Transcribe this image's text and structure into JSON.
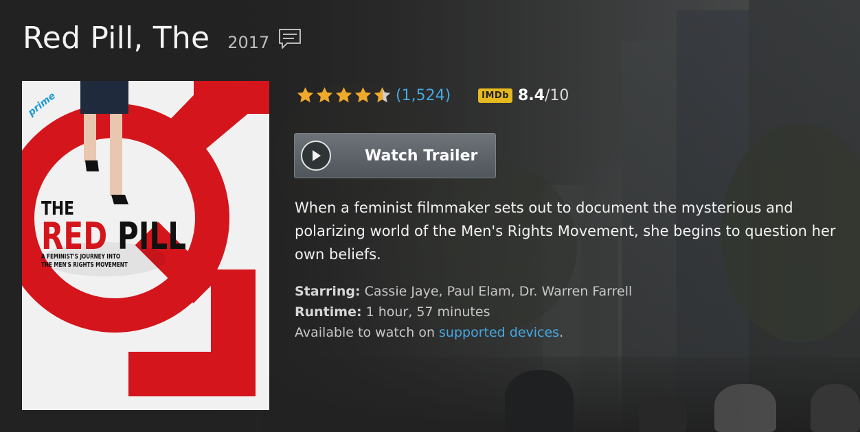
{
  "movie": {
    "title": "Red Pill, The",
    "year": "2017"
  },
  "poster": {
    "badge": "prime",
    "line1": "THE",
    "line2a": "RED",
    "line2b": "PILL",
    "tagline1": "A FEMINIST'S JOURNEY INTO",
    "tagline2": "THE MEN'S RIGHTS MOVEMENT"
  },
  "rating": {
    "stars": 4.5,
    "count_label": "(1,524)",
    "imdb_badge": "IMDb",
    "imdb_score": "8.4",
    "imdb_max": "/10"
  },
  "trailer": {
    "label": "Watch Trailer"
  },
  "synopsis": "When a feminist filmmaker sets out to document the mysterious and polarizing world of the Men's Rights Movement, she begins to question her own beliefs.",
  "details": {
    "starring_label": "Starring:",
    "starring_value": "Cassie Jaye, Paul Elam, Dr. Warren Farrell",
    "runtime_label": "Runtime:",
    "runtime_value": "1 hour, 57 minutes",
    "available_text": "Available to watch on",
    "devices_link": "supported devices",
    "period": "."
  },
  "colors": {
    "link": "#45a8e3",
    "star": "#f0a92b",
    "imdb": "#e6b91e",
    "poster_red": "#d4151c"
  },
  "icons": {
    "comment": "comment-bubble-icon",
    "play": "play-icon",
    "star": "star-icon"
  }
}
